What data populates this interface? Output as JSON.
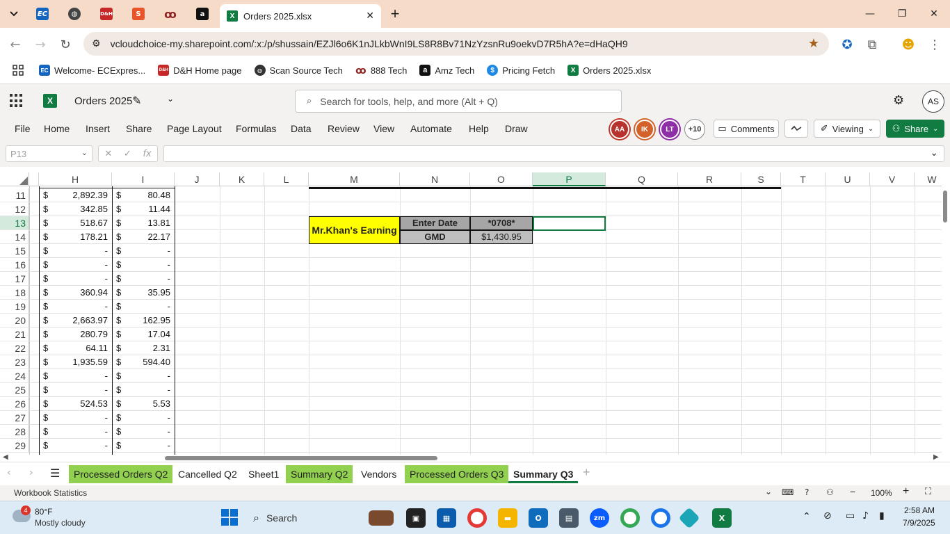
{
  "browser": {
    "tabs": [
      {
        "icon": "menu-chevron-icon"
      },
      {
        "icon": "ec-express-icon",
        "glyph": "EC"
      },
      {
        "icon": "globe-icon",
        "glyph": "◍"
      },
      {
        "icon": "dh-icon",
        "glyph": "D&H"
      },
      {
        "icon": "swirl-s-icon",
        "glyph": "S"
      },
      {
        "icon": "888-tech-icon",
        "glyph": "ꝏ"
      },
      {
        "icon": "amazon-icon",
        "glyph": "a"
      }
    ],
    "active_tab_title": "Orders 2025.xlsx",
    "new_tab": "+",
    "url": "vcloudchoice-my.sharepoint.com/:x:/p/shussain/EZJl6o6K1nJLkbWnI9LS8R8Bv71NzYzsnRu9oekvD7R5hA?e=dHaQH9",
    "bookmarks": [
      {
        "label": "Welcome- ECExpres...",
        "icon": "ec-express-icon",
        "glyph": "EC",
        "color": "#1565c0"
      },
      {
        "label": "D&H Home page",
        "icon": "dh-icon",
        "glyph": "D&H",
        "color": "#c62828"
      },
      {
        "label": "Scan Source Tech",
        "icon": "globe-icon",
        "glyph": "◍",
        "color": "#333333"
      },
      {
        "label": "888 Tech",
        "icon": "888-tech-icon",
        "glyph": "ꝏ",
        "color": "#8e2424"
      },
      {
        "label": "Amz Tech",
        "icon": "amazon-icon",
        "glyph": "a",
        "color": "#111111"
      },
      {
        "label": "Pricing Fetch",
        "icon": "pricing-fetch-icon",
        "glyph": "$",
        "color": "#1e88e5"
      },
      {
        "label": "Orders 2025.xlsx",
        "icon": "excel-icon",
        "glyph": "X",
        "color": "#107c41"
      }
    ]
  },
  "excel": {
    "doc_title": "Orders 2025",
    "search_placeholder": "Search for tools, help, and more (Alt + Q)",
    "user_initials": "AS",
    "ribbon_tabs": [
      "File",
      "Home",
      "Insert",
      "Share",
      "Page Layout",
      "Formulas",
      "Data",
      "Review",
      "View",
      "Automate",
      "Help",
      "Draw"
    ],
    "coauthors": [
      {
        "initials": "AA",
        "color": "#b5322d"
      },
      {
        "initials": "IK",
        "color": "#d3612a"
      },
      {
        "initials": "LT",
        "color": "#8e2fa8"
      }
    ],
    "coauthor_more": "+10",
    "comments_label": "Comments",
    "viewing_label": "Viewing",
    "share_label": "Share",
    "name_box": "P13",
    "columns": [
      "H",
      "I",
      "J",
      "K",
      "L",
      "M",
      "N",
      "O",
      "P",
      "Q",
      "R",
      "S",
      "T",
      "U",
      "V",
      "W"
    ],
    "selected_column": "P",
    "rows": [
      {
        "n": "11",
        "h": "2,892.39",
        "i": "80.48"
      },
      {
        "n": "12",
        "h": "342.85",
        "i": "11.44"
      },
      {
        "n": "13",
        "h": "518.67",
        "i": "13.81"
      },
      {
        "n": "14",
        "h": "178.21",
        "i": "22.17"
      },
      {
        "n": "15",
        "h": "-",
        "i": "-"
      },
      {
        "n": "16",
        "h": "-",
        "i": "-"
      },
      {
        "n": "17",
        "h": "-",
        "i": "-"
      },
      {
        "n": "18",
        "h": "360.94",
        "i": "35.95"
      },
      {
        "n": "19",
        "h": "-",
        "i": "-"
      },
      {
        "n": "20",
        "h": "2,663.97",
        "i": "162.95"
      },
      {
        "n": "21",
        "h": "280.79",
        "i": "17.04"
      },
      {
        "n": "22",
        "h": "64.11",
        "i": "2.31"
      },
      {
        "n": "23",
        "h": "1,935.59",
        "i": "594.40"
      },
      {
        "n": "24",
        "h": "-",
        "i": "-"
      },
      {
        "n": "25",
        "h": "-",
        "i": "-"
      },
      {
        "n": "26",
        "h": "524.53",
        "i": "5.53"
      },
      {
        "n": "27",
        "h": "-",
        "i": "-"
      },
      {
        "n": "28",
        "h": "-",
        "i": "-"
      },
      {
        "n": "29",
        "h": "-",
        "i": "-"
      }
    ],
    "currency_symbol": "$",
    "selected_row": "13",
    "earning_box": {
      "title": "Mr.Khan's Earning",
      "enter_date_label": "Enter Date",
      "date_value": "*0708*",
      "gmd_label": "GMD",
      "gmd_value": "$1,430.95"
    },
    "sheet_tabs": [
      {
        "label": "Processed Orders Q2",
        "style": "green"
      },
      {
        "label": "Cancelled Q2",
        "style": "plain"
      },
      {
        "label": "Sheet1",
        "style": "plain"
      },
      {
        "label": "Summary Q2",
        "style": "green"
      },
      {
        "label": "Vendors",
        "style": "plain"
      },
      {
        "label": "Processed Orders Q3",
        "style": "green"
      },
      {
        "label": "Summary Q3",
        "style": "active"
      }
    ],
    "add_sheet": "+",
    "status_text": "Workbook Statistics",
    "zoom": "100%"
  },
  "taskbar": {
    "weather_badge": "4",
    "temperature": "80°F",
    "condition": "Mostly cloudy",
    "search_label": "Search",
    "time": "2:58 AM",
    "date": "7/9/2025"
  }
}
